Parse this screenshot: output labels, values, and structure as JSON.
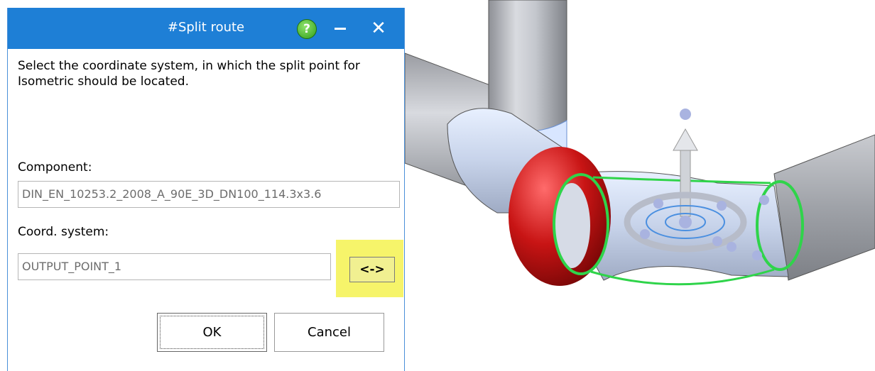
{
  "dialog": {
    "title": "#Split route",
    "help_icon": "question-mark-icon",
    "minimize_icon": "minimize-icon",
    "close_icon": "close-icon",
    "help_glyph": "?",
    "close_glyph": "✕",
    "instruction": "Select the coordinate system, in which the split point for Isometric should be located.",
    "component_label": "Component:",
    "component_value": "DIN_EN_10253.2_2008_A_90E_3D_DN100_114.3x3.6",
    "coord_label": "Coord. system:",
    "coord_value": "OUTPUT_POINT_1",
    "swap_label": "<->",
    "ok_label": "OK",
    "cancel_label": "Cancel"
  },
  "colors": {
    "titlebar": "#1e7fd6",
    "highlight": "#f6f46a",
    "sphere": "#cc1a1a",
    "split_ring": "#2fd44a"
  }
}
